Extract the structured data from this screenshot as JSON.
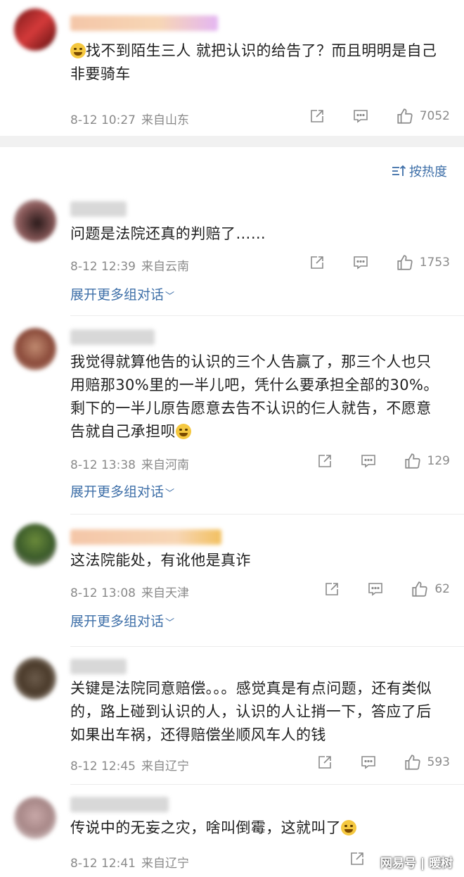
{
  "colors": {
    "accent": "#3e6fa8",
    "meta": "#8a8a8a",
    "band": "#f1f1f1"
  },
  "sort_label": "按热度",
  "expand_label": "展开更多组对话",
  "watermark": "网易号 | 暖树",
  "comments": [
    {
      "text": "找不到陌生三人 就把认识的给告了？而且明明是自己非要骑车",
      "emoji": "smirk-emoji",
      "date": "8-12 10:27",
      "location": "来自山东",
      "likes": "7052"
    },
    {
      "text": "问题是法院还真的判赔了……",
      "date": "8-12 12:39",
      "location": "来自云南",
      "likes": "1753"
    },
    {
      "text": "我觉得就算他告的认识的三个人告赢了，那三个人也只用赔那30%里的一半儿吧，凭什么要承担全部的30%。剩下的一半儿原告愿意去告不认识的仨人就告，不愿意告就自己承担呗",
      "emoji": "laugh-emoji",
      "date": "8-12 13:38",
      "location": "来自河南",
      "likes": "129"
    },
    {
      "text": "这法院能处，有讹他是真诈",
      "date": "8-12 13:08",
      "location": "来自天津",
      "likes": "62"
    },
    {
      "text": "关键是法院同意赔偿。。。感觉真是有点问题，还有类似的，路上碰到认识的人，认识的人让捎一下，答应了后如果出车祸，还得赔偿坐顺风车人的钱",
      "date": "8-12 12:45",
      "location": "来自辽宁",
      "likes": "593"
    },
    {
      "text": "传说中的无妄之灾，啥叫倒霉，这就叫了",
      "emoji": "laugh-emoji",
      "date": "8-12 12:41",
      "location": "来自辽宁",
      "likes": ""
    }
  ]
}
